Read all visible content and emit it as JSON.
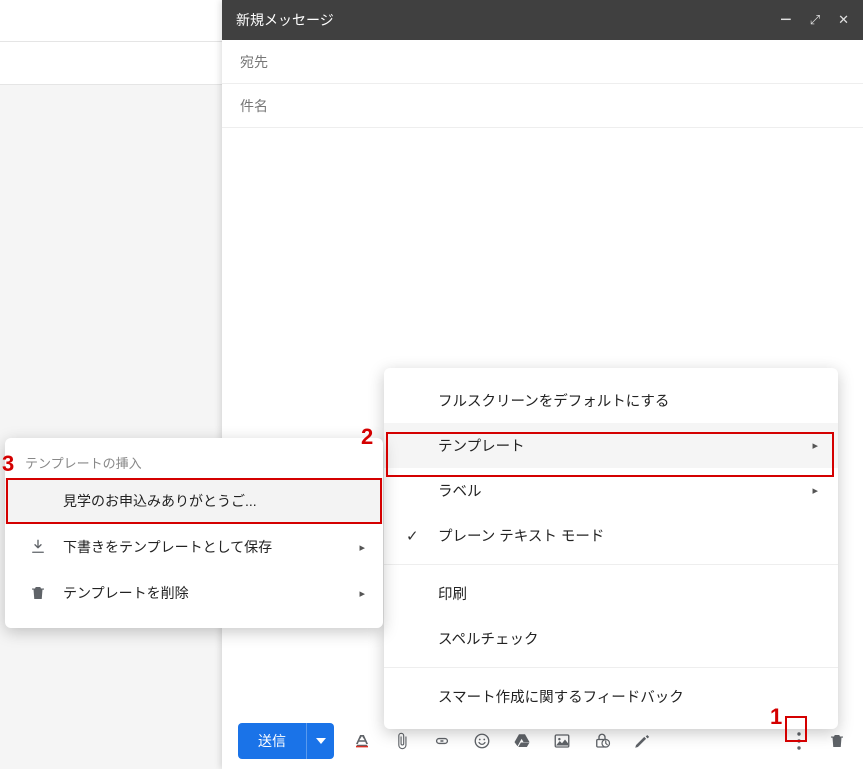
{
  "compose": {
    "title": "新規メッセージ",
    "to_label": "宛先",
    "subject_label": "件名",
    "send_label": "送信"
  },
  "menu1": {
    "fullscreen": "フルスクリーンをデフォルトにする",
    "templates": "テンプレート",
    "labels": "ラベル",
    "plaintext": "プレーン テキスト モード",
    "print": "印刷",
    "spellcheck": "スペルチェック",
    "smartcompose": "スマート作成に関するフィードバック"
  },
  "menu2": {
    "header": "テンプレートの挿入",
    "insert_item": "見学のお申込みありがとうご...",
    "save_draft": "下書きをテンプレートとして保存",
    "delete_template": "テンプレートを削除"
  },
  "annotations": {
    "n1": "1",
    "n2": "2",
    "n3": "3"
  }
}
